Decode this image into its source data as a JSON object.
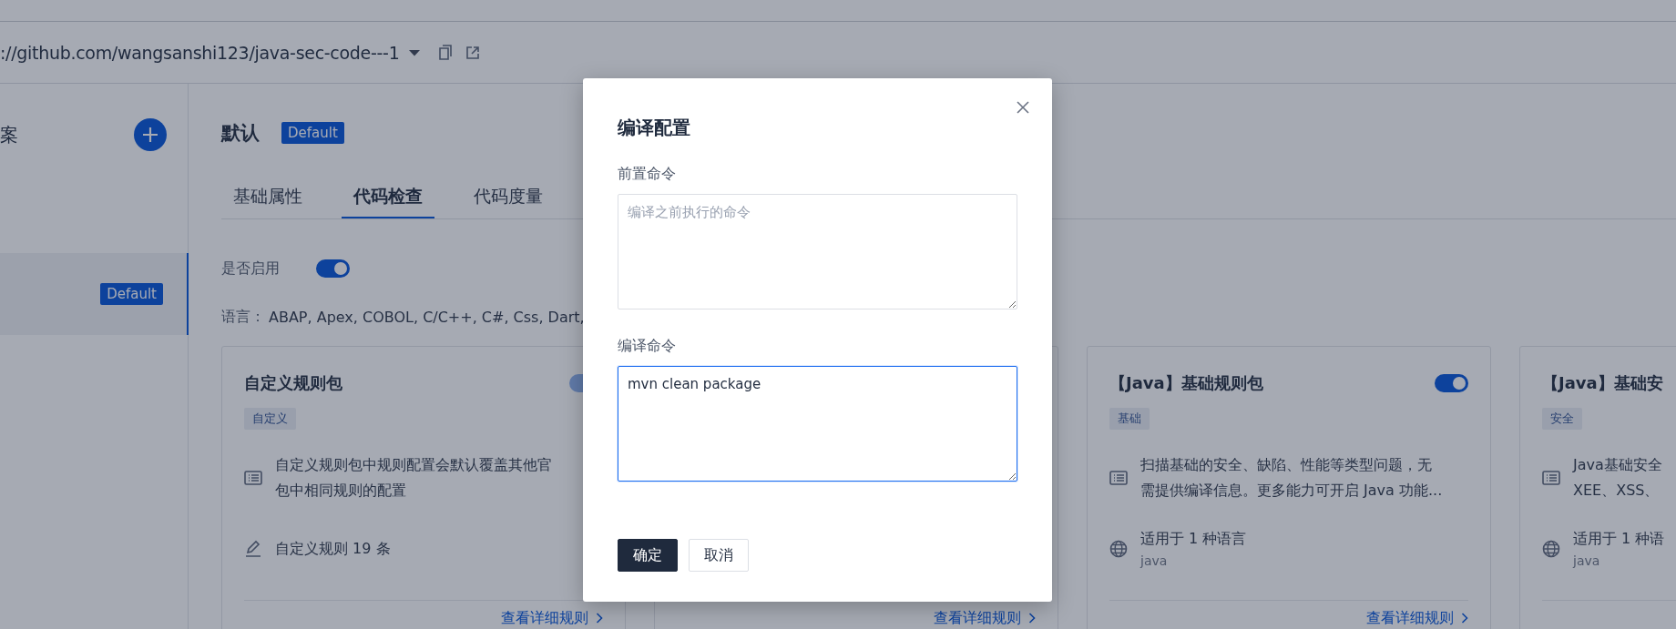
{
  "repo": {
    "url": "://github.com/wangsanshi123/java-sec-code---1"
  },
  "sidebar": {
    "heading": "案",
    "items": [
      {
        "badge": "Default",
        "selected": true
      }
    ]
  },
  "scheme": {
    "title": "默认",
    "badge": "Default"
  },
  "tabs": [
    {
      "label": "基础属性",
      "selected": false
    },
    {
      "label": "代码检查",
      "selected": true
    },
    {
      "label": "代码度量",
      "selected": false
    }
  ],
  "enabled": {
    "label": "是否启用",
    "on": true
  },
  "languages": {
    "label": "语言：",
    "value": "ABAP, Apex, COBOL, C/C++, C#, Css, Dart,"
  },
  "cards": [
    {
      "title": "自定义规则包",
      "toggle": {
        "on": true,
        "disabled": true
      },
      "tag": "自定义",
      "description_lines": [
        "自定义规则包中规则配置会默认覆盖其他官",
        "包中相同规则的配置"
      ],
      "info": {
        "kind": "custom",
        "text": "自定义规则 19 条"
      },
      "link": "查看详细规则"
    },
    {
      "link": "查看详细规则"
    },
    {
      "title": "【Java】基础规则包",
      "toggle": {
        "on": true,
        "disabled": false
      },
      "tag": "基础",
      "description_lines": [
        "扫描基础的安全、缺陷、性能等类型问题，无",
        "需提供编译信息。更多能力可开启 Java 功能..."
      ],
      "info": {
        "kind": "language",
        "text": "适用于 1 种语言",
        "sub": "java"
      },
      "link": "查看详细规则"
    },
    {
      "title": "【Java】基础安",
      "tag": "安全",
      "description_lines": [
        "Java基础安全",
        "XEE、XSS、"
      ],
      "info": {
        "kind": "language",
        "text": "适用于 1 种语",
        "sub": "java"
      }
    }
  ],
  "dialog": {
    "title": "编译配置",
    "fields": [
      {
        "label": "前置命令",
        "placeholder": "编译之前执行的命令",
        "focused": false
      },
      {
        "label": "编译命令",
        "value": "mvn clean package",
        "focused": true
      }
    ],
    "buttons": [
      {
        "label": "确定",
        "kind": "primary"
      },
      {
        "label": "取消",
        "kind": "default"
      }
    ]
  }
}
